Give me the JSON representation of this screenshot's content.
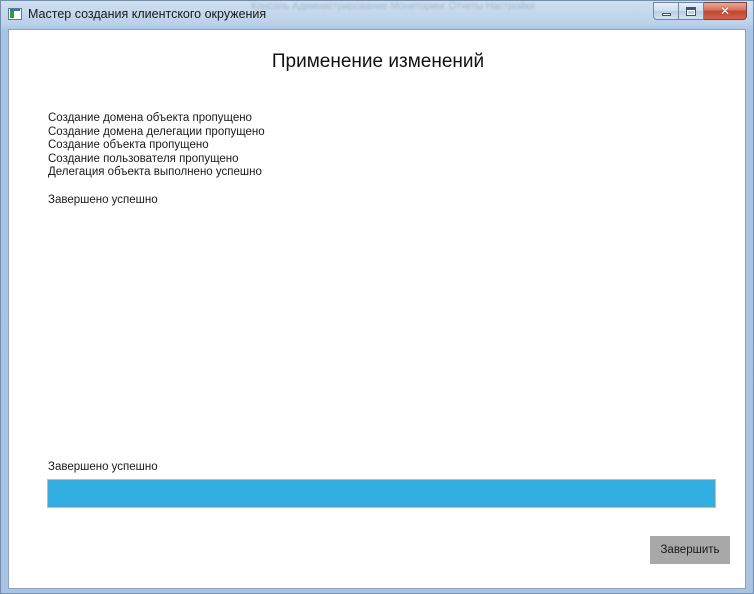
{
  "window": {
    "title": "Мастер создания клиентского окружения",
    "background_menu_text": "Консоль   Администрирование   Мониторинг   Отчеты   Настройки",
    "buttons": {
      "minimize_icon": "minimize-icon",
      "maximize_icon": "maximize-icon",
      "close_glyph": "✕"
    }
  },
  "page": {
    "heading": "Применение изменений",
    "log_lines": [
      "Создание домена объекта пропущено",
      "Создание домена делегации пропущено",
      "Создание объекта пропущено",
      "Создание пользователя пропущено",
      "Делегация объекта выполнено успешно"
    ],
    "log_result": "Завершено успешно",
    "status_text": "Завершено успешно",
    "progress_percent": 100,
    "finish_label": "Завершить"
  },
  "colors": {
    "progress_fill": "#33aee2",
    "finish_button_bg": "#a8a8a8"
  }
}
